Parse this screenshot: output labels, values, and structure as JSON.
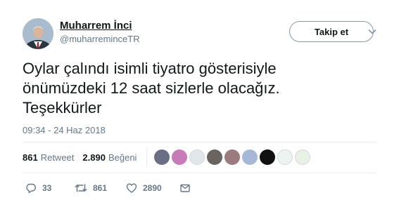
{
  "user": {
    "display_name": "Muharrem İnci",
    "screen_name": "@muharreminceTR",
    "avatar_icon": "profile-photo"
  },
  "follow_button_label": "Takip et",
  "tweet": {
    "text": "Oylar çalındı isimli tiyatro gösterisiyle\nönümüzdeki 12 saat sizlerle olacağız.\nTeşekkürler",
    "timestamp": "09:34 - 24 Haz 2018"
  },
  "stats": {
    "retweets_value": "861",
    "retweets_label": "Retweet",
    "likes_value": "2.890",
    "likes_label": "Beğeni"
  },
  "liker_avatars": [
    {
      "color": "#6b6f86"
    },
    {
      "color": "#c77bb9"
    },
    {
      "color": "#e0e6ea"
    },
    {
      "color": "#6a6460"
    },
    {
      "color": "#9b7a80"
    },
    {
      "color": "#a7b7d6"
    },
    {
      "color": "#111111"
    },
    {
      "color": "#eef2f0"
    },
    {
      "color": "#eaf1e4"
    }
  ],
  "actions": {
    "reply_count": "33",
    "retweet_count": "861",
    "like_count": "2890"
  },
  "colors": {
    "text": "#14171a",
    "secondary": "#657786",
    "border": "#e6ecf0"
  }
}
